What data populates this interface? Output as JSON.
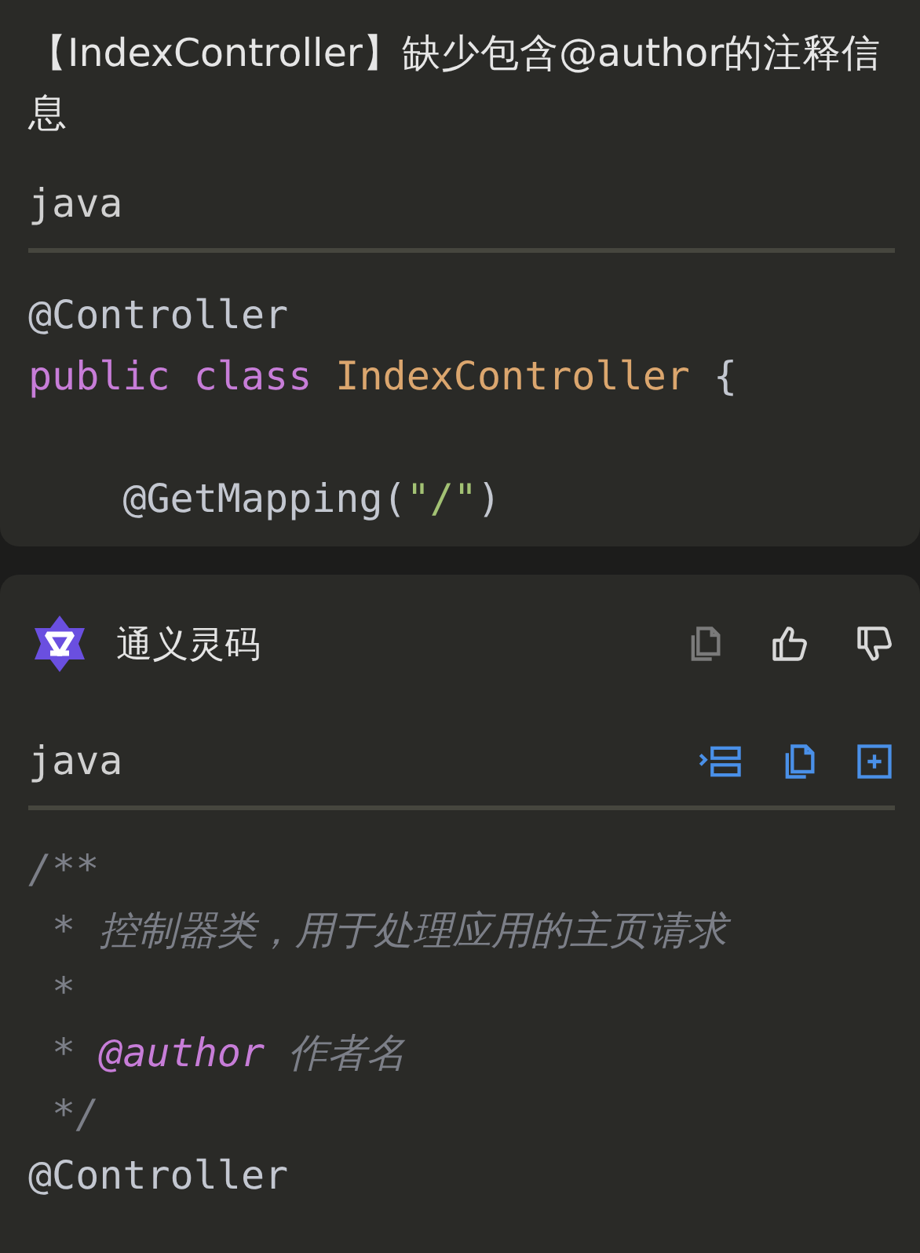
{
  "question": {
    "text": "【IndexController】缺少包含@author的注释信息",
    "code_block": {
      "language": "java",
      "lines": [
        {
          "kind": "code",
          "tokens": [
            {
              "text": "@Controller",
              "kind": "plain"
            }
          ]
        },
        {
          "kind": "code",
          "tokens": [
            {
              "text": "public ",
              "kind": "keyword"
            },
            {
              "text": "class ",
              "kind": "keyword"
            },
            {
              "text": "IndexController",
              "kind": "type"
            },
            {
              "text": " {",
              "kind": "plain"
            }
          ]
        },
        {
          "kind": "blank"
        },
        {
          "kind": "code",
          "tokens": [
            {
              "text": "    @GetMapping(",
              "kind": "plain"
            },
            {
              "text": "\"/\"",
              "kind": "string"
            },
            {
              "text": ")",
              "kind": "plain"
            }
          ]
        }
      ]
    }
  },
  "answer": {
    "assistant_name": "通义灵码",
    "code_block": {
      "language": "java",
      "lines": [
        {
          "kind": "code",
          "tokens": [
            {
              "text": "/**",
              "kind": "comment"
            }
          ]
        },
        {
          "kind": "code",
          "tokens": [
            {
              "text": " * 控制器类，用于处理应用的主页请求",
              "kind": "comment"
            }
          ]
        },
        {
          "kind": "code",
          "tokens": [
            {
              "text": " *",
              "kind": "comment"
            }
          ]
        },
        {
          "kind": "code",
          "tokens": [
            {
              "text": " * ",
              "kind": "comment"
            },
            {
              "text": "@author",
              "kind": "doctag"
            },
            {
              "text": " 作者名",
              "kind": "comment"
            }
          ]
        },
        {
          "kind": "code",
          "tokens": [
            {
              "text": " */",
              "kind": "comment"
            }
          ]
        },
        {
          "kind": "code",
          "tokens": [
            {
              "text": "@Controller",
              "kind": "plain"
            }
          ]
        }
      ]
    }
  }
}
